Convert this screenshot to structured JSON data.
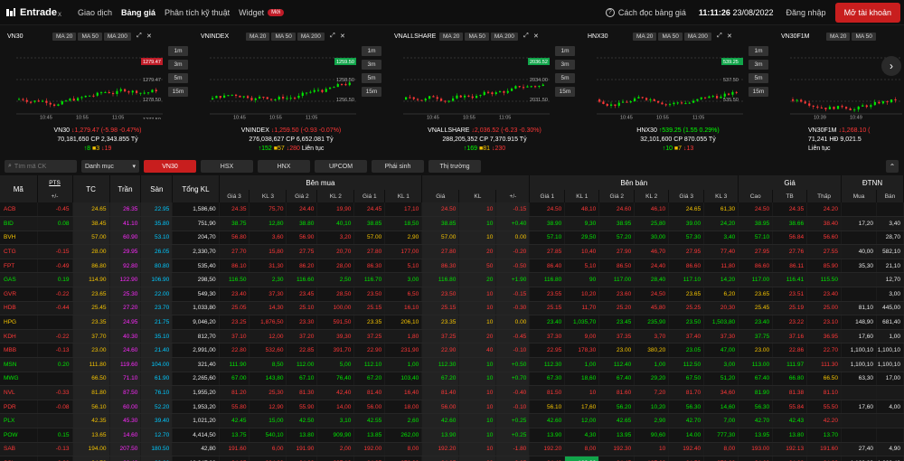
{
  "nav": {
    "brand": "Entrade",
    "brand_sup": "X",
    "items": [
      "Giao dịch",
      "Bảng giá",
      "Phân tích kỹ thuật",
      "Widget"
    ],
    "active_index": 1,
    "badge": "Mới",
    "help": "Cách đọc bảng giá",
    "time": "11:11:26",
    "date": "23/08/2022",
    "login": "Đăng nhập",
    "open_account": "Mở tài khoản"
  },
  "colors": {
    "up": "#00e600",
    "down": "#ff3737",
    "ref": "#f5c300",
    "ceil": "#ff29ff",
    "floor": "#00c9ff",
    "accent": "#c81e1e"
  },
  "chart_data": [
    {
      "type": "candlestick",
      "title": "VN30",
      "ma_buttons": [
        "MA 20",
        "MA 50",
        "MA 200"
      ],
      "timeframes": [
        "1m",
        "3m",
        "5m",
        "15m"
      ],
      "x_ticks": [
        "10:45",
        "10:55",
        "11:05"
      ],
      "price_ticks": [
        "1279.84",
        "1279.47",
        "1278.50",
        "1277.50"
      ],
      "current": "1279.47",
      "footer": {
        "name": "VN30",
        "change": "1,279.47 (-5.98 -0.47%)",
        "volume": "70,181,650 CP",
        "value": "2,343.855 Tỷ",
        "up": "8",
        "ref": "3",
        "down": "19"
      }
    },
    {
      "type": "candlestick",
      "title": "VNINDEX",
      "ma_buttons": [
        "MA 20",
        "MA 50",
        "MA 200"
      ],
      "timeframes": [
        "1m",
        "3m",
        "5m",
        "15m"
      ],
      "x_ticks": [
        "10:45",
        "10:55",
        "11:05"
      ],
      "price_ticks": [
        "1259.50",
        "1258.50",
        "1256.50"
      ],
      "current": "1259.50",
      "footer": {
        "name": "VNINDEX",
        "change": "1,259.50 (-0.93 -0.07%)",
        "volume": "276,038,627 CP",
        "value": "6,652.081 Tỷ",
        "up": "152",
        "ref": "57",
        "down": "280",
        "status": "Liên tục"
      }
    },
    {
      "type": "candlestick",
      "title": "VNALLSHARE",
      "ma_buttons": [
        "MA 20",
        "MA 50",
        "MA 200"
      ],
      "timeframes": [
        "1m",
        "3m",
        "5m",
        "15m"
      ],
      "x_ticks": [
        "10:45",
        "10:55",
        "11:05"
      ],
      "price_ticks": [
        "2036.52",
        "2034.00",
        "2031.50"
      ],
      "current": "2036.52",
      "footer": {
        "name": "VNALLSHARE",
        "change": "2,036.52 (-6.23 -0.30%)",
        "volume": "288,205,352 CP",
        "value": "7,370.915 Tỷ",
        "up": "169",
        "ref": "81",
        "down": "230"
      }
    },
    {
      "type": "candlestick",
      "title": "HNX30",
      "ma_buttons": [
        "MA 20",
        "MA 50",
        "MA 200"
      ],
      "timeframes": [
        "1m",
        "3m",
        "5m",
        "15m"
      ],
      "x_ticks": [
        "10:45",
        "10:55",
        "11:05"
      ],
      "price_ticks": [
        "539.25",
        "537.50",
        "535.50"
      ],
      "current": "539.25",
      "footer": {
        "name": "HNX30",
        "change": "539.25 (1.55 0.29%)",
        "volume": "32,101,600 CP",
        "value": "870.055 Tỷ",
        "up": "10",
        "ref": "7",
        "down": "13"
      }
    },
    {
      "type": "candlestick",
      "title": "VN30F1M",
      "ma_buttons": [
        "MA 20",
        "MA 50"
      ],
      "timeframes": [],
      "x_ticks": [
        "10:39",
        "10:49"
      ],
      "price_ticks": [],
      "current": "",
      "footer": {
        "name": "VN30F1M",
        "change": "1,268.10 (",
        "volume": "71,241 HĐ",
        "value": "9,021.5",
        "status": "Liên tục"
      }
    }
  ],
  "filter": {
    "search_placeholder": "Tìm mã CK",
    "category": "Danh mục",
    "tabs": [
      "VN30",
      "HSX",
      "HNX",
      "UPCOM",
      "Phái sinh",
      "Thị trường"
    ],
    "active_tab": 0
  },
  "table": {
    "groups": {
      "pts": "PTS",
      "buy": "Bên mua",
      "sell": "Bên bán",
      "price": "Giá",
      "foreign": "ĐTNN"
    },
    "cols": {
      "symbol": "Mã",
      "pm": "+/-",
      "tc": "TC",
      "tran": "Trần",
      "san": "Sàn",
      "total": "Tổng KL",
      "g3": "Giá 3",
      "k3": "KL 3",
      "g2": "Giá 2",
      "k2": "KL 2",
      "g1": "Giá 1",
      "k1": "KL 1",
      "gia": "Giá",
      "kl": "KL",
      "pm2": "+/-",
      "cao": "Cao",
      "tb": "TB",
      "thap": "Thấp",
      "mua": "Mua",
      "ban": "Bán"
    },
    "rows": [
      {
        "s": "ACB",
        "pts": "-0.45",
        "tc": "24.65",
        "tr": "26.35",
        "sa": "22.95",
        "tot": "1,586,60",
        "b": [
          [
            "24.35",
            "75,70"
          ],
          [
            "24.40",
            "19,90"
          ],
          [
            "24.45",
            "17,10"
          ]
        ],
        "m": [
          "24.50",
          "10",
          "-0.15"
        ],
        "a": [
          [
            "24.50",
            "48,10"
          ],
          [
            "24.60",
            "46,10"
          ],
          [
            "24.65",
            "61,30"
          ]
        ],
        "hi": "24.50",
        "tb": "24.35",
        "lo": "24.20",
        "fb": "",
        "fs": "",
        "col": "d"
      },
      {
        "s": "BID",
        "pts": "0.08",
        "tc": "38.45",
        "tr": "41.10",
        "sa": "35.80",
        "tot": "751,90",
        "b": [
          [
            "38.75",
            "12,80"
          ],
          [
            "38.80",
            "40,10"
          ],
          [
            "38.85",
            "18,50"
          ]
        ],
        "m": [
          "38.85",
          "10",
          "+0.40"
        ],
        "a": [
          [
            "38.90",
            "9,30"
          ],
          [
            "38.95",
            "25,80"
          ],
          [
            "39.00",
            "24,20"
          ]
        ],
        "hi": "38.95",
        "tb": "38.66",
        "lo": "38.40",
        "fb": "17,20",
        "fs": "3,40",
        "col": "u"
      },
      {
        "s": "BVH",
        "pts": "",
        "tc": "57.00",
        "tr": "60.90",
        "sa": "53.10",
        "tot": "204,70",
        "b": [
          [
            "56.80",
            "3,60"
          ],
          [
            "56.90",
            "3,20"
          ],
          [
            "57.00",
            "2,90"
          ]
        ],
        "m": [
          "57.00",
          "10",
          "0.00"
        ],
        "a": [
          [
            "57.10",
            "29,50"
          ],
          [
            "57.20",
            "30,00"
          ],
          [
            "57.30",
            "3,40"
          ]
        ],
        "hi": "57.10",
        "tb": "56.84",
        "lo": "56.60",
        "fb": "",
        "fs": "28,70",
        "col": "r"
      },
      {
        "s": "CTG",
        "pts": "-0.15",
        "tc": "28.00",
        "tr": "29.95",
        "sa": "26.05",
        "tot": "2,330,70",
        "b": [
          [
            "27.70",
            "15,80"
          ],
          [
            "27.75",
            "20,70"
          ],
          [
            "27.80",
            "177,00"
          ]
        ],
        "m": [
          "27.80",
          "20",
          "-0.20"
        ],
        "a": [
          [
            "27.85",
            "10,40"
          ],
          [
            "27.90",
            "46,70"
          ],
          [
            "27.95",
            "77,40"
          ]
        ],
        "hi": "27.95",
        "tb": "27.76",
        "lo": "27.55",
        "fb": "40,00",
        "fs": "582,10",
        "col": "d"
      },
      {
        "s": "FPT",
        "pts": "-0.49",
        "tc": "86.80",
        "tr": "92.80",
        "sa": "80.80",
        "tot": "535,40",
        "b": [
          [
            "86.10",
            "31,30"
          ],
          [
            "86.20",
            "28,00"
          ],
          [
            "86.30",
            "5,10"
          ]
        ],
        "m": [
          "86.30",
          "50",
          "-0.50"
        ],
        "a": [
          [
            "86.40",
            "5,10"
          ],
          [
            "86.50",
            "24,40"
          ],
          [
            "86.60",
            "11,80"
          ]
        ],
        "hi": "86.60",
        "tb": "86.11",
        "lo": "85.90",
        "fb": "35,30",
        "fs": "21,10",
        "col": "d"
      },
      {
        "s": "GAS",
        "pts": "0.19",
        "tc": "114.90",
        "tr": "122.90",
        "sa": "106.90",
        "tot": "298,50",
        "b": [
          [
            "116.50",
            "2,30"
          ],
          [
            "116.60",
            "2,50"
          ],
          [
            "116.70",
            "3,00"
          ]
        ],
        "m": [
          "116.80",
          "20",
          "+1.90"
        ],
        "a": [
          [
            "116.80",
            "90"
          ],
          [
            "117.00",
            "28,40"
          ],
          [
            "117.10",
            "14,20"
          ]
        ],
        "hi": "117.00",
        "tb": "116.41",
        "lo": "115.50",
        "fb": "",
        "fs": "12,70",
        "col": "u"
      },
      {
        "s": "GVR",
        "pts": "-0.22",
        "tc": "23.65",
        "tr": "25.30",
        "sa": "22.00",
        "tot": "549,30",
        "b": [
          [
            "23.40",
            "37,30"
          ],
          [
            "23.45",
            "28,50"
          ],
          [
            "23.50",
            "6,50"
          ]
        ],
        "m": [
          "23.50",
          "10",
          "-0.15"
        ],
        "a": [
          [
            "23.55",
            "10,20"
          ],
          [
            "23.60",
            "24,50"
          ],
          [
            "23.65",
            "6,20"
          ]
        ],
        "hi": "23.65",
        "tb": "23.51",
        "lo": "23.40",
        "fb": "",
        "fs": "3,00",
        "col": "d"
      },
      {
        "s": "HDB",
        "pts": "-0.44",
        "tc": "25.45",
        "tr": "27.20",
        "sa": "23.70",
        "tot": "1,033,80",
        "b": [
          [
            "25.05",
            "14,30"
          ],
          [
            "25.10",
            "100,00"
          ],
          [
            "25.15",
            "16,10"
          ]
        ],
        "m": [
          "25.15",
          "10",
          "-0.30"
        ],
        "a": [
          [
            "25.15",
            "11,70"
          ],
          [
            "25.20",
            "45,80"
          ],
          [
            "25.25",
            "20,30"
          ]
        ],
        "hi": "25.45",
        "tb": "25.19",
        "lo": "25.00",
        "fb": "81,10",
        "fs": "445,00",
        "col": "d"
      },
      {
        "s": "HPG",
        "pts": "",
        "tc": "23.35",
        "tr": "24.95",
        "sa": "21.75",
        "tot": "9,046,20",
        "b": [
          [
            "23.25",
            "1,876,50"
          ],
          [
            "23.30",
            "591,50"
          ],
          [
            "23.35",
            "206,10"
          ]
        ],
        "m": [
          "23.35",
          "10",
          "0.00"
        ],
        "a": [
          [
            "23.40",
            "1,035,70"
          ],
          [
            "23.45",
            "235,90"
          ],
          [
            "23.50",
            "1,503,80"
          ]
        ],
        "hi": "23.40",
        "tb": "23.22",
        "lo": "23.10",
        "fb": "148,90",
        "fs": "681,40",
        "col": "r"
      },
      {
        "s": "KDH",
        "pts": "-0.22",
        "tc": "37.70",
        "tr": "40.30",
        "sa": "35.10",
        "tot": "812,70",
        "b": [
          [
            "37.10",
            "12,00"
          ],
          [
            "37.20",
            "39,30"
          ],
          [
            "37.25",
            "1,80"
          ]
        ],
        "m": [
          "37.25",
          "20",
          "-0.45"
        ],
        "a": [
          [
            "37.30",
            "9,00"
          ],
          [
            "37.35",
            "3,70"
          ],
          [
            "37.40",
            "37,30"
          ]
        ],
        "hi": "37.75",
        "tb": "37.16",
        "lo": "36.95",
        "fb": "17,60",
        "fs": "1,00",
        "col": "d"
      },
      {
        "s": "MBB",
        "pts": "-0.13",
        "tc": "23.00",
        "tr": "24.60",
        "sa": "21.40",
        "tot": "2,991,00",
        "b": [
          [
            "22.80",
            "532,60"
          ],
          [
            "22.85",
            "391,70"
          ],
          [
            "22.90",
            "231,90"
          ]
        ],
        "m": [
          "22.90",
          "40",
          "-0.10"
        ],
        "a": [
          [
            "22.95",
            "178,30"
          ],
          [
            "23.00",
            "380,20"
          ],
          [
            "23.05",
            "47,00"
          ]
        ],
        "hi": "23.00",
        "tb": "22.86",
        "lo": "22.70",
        "fb": "1,100,10",
        "fs": "1,100,10",
        "col": "d"
      },
      {
        "s": "MSN",
        "pts": "0.20",
        "tc": "111.80",
        "tr": "119.60",
        "sa": "104.00",
        "tot": "321,40",
        "b": [
          [
            "111.90",
            "8,50"
          ],
          [
            "112.00",
            "5,00"
          ],
          [
            "112.10",
            "1,00"
          ]
        ],
        "m": [
          "112.30",
          "10",
          "+0.50"
        ],
        "a": [
          [
            "112.30",
            "1,00"
          ],
          [
            "112.40",
            "1,00"
          ],
          [
            "112.50",
            "3,00"
          ]
        ],
        "hi": "113.00",
        "tb": "111.97",
        "lo": "111.30",
        "fb": "1,100,10",
        "fs": "1,100,10",
        "col": "u"
      },
      {
        "s": "MWG",
        "pts": "",
        "tc": "66.50",
        "tr": "71.10",
        "sa": "61.90",
        "tot": "2,265,60",
        "b": [
          [
            "67.00",
            "143,80"
          ],
          [
            "67.10",
            "76,40"
          ],
          [
            "67.20",
            "103,40"
          ]
        ],
        "m": [
          "67.20",
          "10",
          "+0.70"
        ],
        "a": [
          [
            "67.30",
            "18,60"
          ],
          [
            "67.40",
            "29,20"
          ],
          [
            "67.50",
            "51,20"
          ]
        ],
        "hi": "67.40",
        "tb": "66.80",
        "lo": "66.50",
        "fb": "63,30",
        "fs": "17,00",
        "col": "u"
      },
      {
        "s": "NVL",
        "pts": "-0.33",
        "tc": "81.80",
        "tr": "87.50",
        "sa": "76.10",
        "tot": "1,955,20",
        "b": [
          [
            "81.20",
            "25,30"
          ],
          [
            "81.30",
            "42,40"
          ],
          [
            "81.40",
            "16,40"
          ]
        ],
        "m": [
          "81.40",
          "10",
          "-0.40"
        ],
        "a": [
          [
            "81.50",
            "10"
          ],
          [
            "81.60",
            "7,20"
          ],
          [
            "81.70",
            "34,60"
          ]
        ],
        "hi": "81.90",
        "tb": "81.38",
        "lo": "81.10",
        "fb": "",
        "fs": "",
        "col": "d"
      },
      {
        "s": "PDR",
        "pts": "-0.08",
        "tc": "56.10",
        "tr": "60.00",
        "sa": "52.20",
        "tot": "1,953,20",
        "b": [
          [
            "55.80",
            "12,90"
          ],
          [
            "55.90",
            "14,00"
          ],
          [
            "56.00",
            "18,00"
          ]
        ],
        "m": [
          "56.00",
          "10",
          "-0.10"
        ],
        "a": [
          [
            "56.10",
            "17,60"
          ],
          [
            "56.20",
            "10,20"
          ],
          [
            "56.30",
            "14,60"
          ]
        ],
        "hi": "56.30",
        "tb": "55.84",
        "lo": "55.50",
        "fb": "17,60",
        "fs": "4,00",
        "col": "d"
      },
      {
        "s": "PLX",
        "pts": "",
        "tc": "42.35",
        "tr": "45.30",
        "sa": "39.40",
        "tot": "1,021,20",
        "b": [
          [
            "42.45",
            "15,00"
          ],
          [
            "42.50",
            "3,10"
          ],
          [
            "42.55",
            "2,60"
          ]
        ],
        "m": [
          "42.60",
          "10",
          "+0.25"
        ],
        "a": [
          [
            "42.60",
            "12,00"
          ],
          [
            "42.65",
            "2,90"
          ],
          [
            "42.70",
            "7,00"
          ]
        ],
        "hi": "42.70",
        "tb": "42.43",
        "lo": "42.20",
        "fb": "",
        "fs": "",
        "col": "u"
      },
      {
        "s": "POW",
        "pts": "0.15",
        "tc": "13.65",
        "tr": "14.60",
        "sa": "12.70",
        "tot": "4,414,50",
        "b": [
          [
            "13.75",
            "540,10"
          ],
          [
            "13.80",
            "909,90"
          ],
          [
            "13.85",
            "262,00"
          ]
        ],
        "m": [
          "13.90",
          "10",
          "+0.25"
        ],
        "a": [
          [
            "13.90",
            "4,30"
          ],
          [
            "13.95",
            "90,60"
          ],
          [
            "14.00",
            "777,30"
          ]
        ],
        "hi": "13.95",
        "tb": "13.80",
        "lo": "13.70",
        "fb": "",
        "fs": "",
        "col": "u"
      },
      {
        "s": "SAB",
        "pts": "-0.13",
        "tc": "194.00",
        "tr": "207.50",
        "sa": "180.50",
        "tot": "42,80",
        "b": [
          [
            "191.60",
            "6,00"
          ],
          [
            "191.90",
            "2,00"
          ],
          [
            "192.00",
            "8,00"
          ]
        ],
        "m": [
          "192.20",
          "10",
          "-1.80"
        ],
        "a": [
          [
            "192.20",
            "8,00"
          ],
          [
            "192.30",
            "10"
          ],
          [
            "192.40",
            "8,00"
          ]
        ],
        "hi": "193.00",
        "tb": "192.13",
        "lo": "191.60",
        "fb": "27,40",
        "fs": "4,90",
        "col": "d"
      },
      {
        "s": "SSI",
        "pts": "-0.38",
        "tc": "24.70",
        "tr": "26.40",
        "sa": "23.00",
        "tot": "18,347,20",
        "b": [
          [
            "24.25",
            "294,20"
          ],
          [
            "24.30",
            "227,10"
          ],
          [
            "24.35",
            "270,00"
          ]
        ],
        "m": [
          "24.35",
          "20",
          "-0.35"
        ],
        "a": [
          [
            "24.40",
            "129,90"
          ],
          [
            "24.45",
            "197,60"
          ],
          [
            "24.50",
            "270,20"
          ]
        ],
        "hi": "24.60",
        "tb": "24.38",
        "lo": "24.20",
        "fb": "1,130,80",
        "fs": "1,233,40",
        "col": "d"
      }
    ]
  }
}
